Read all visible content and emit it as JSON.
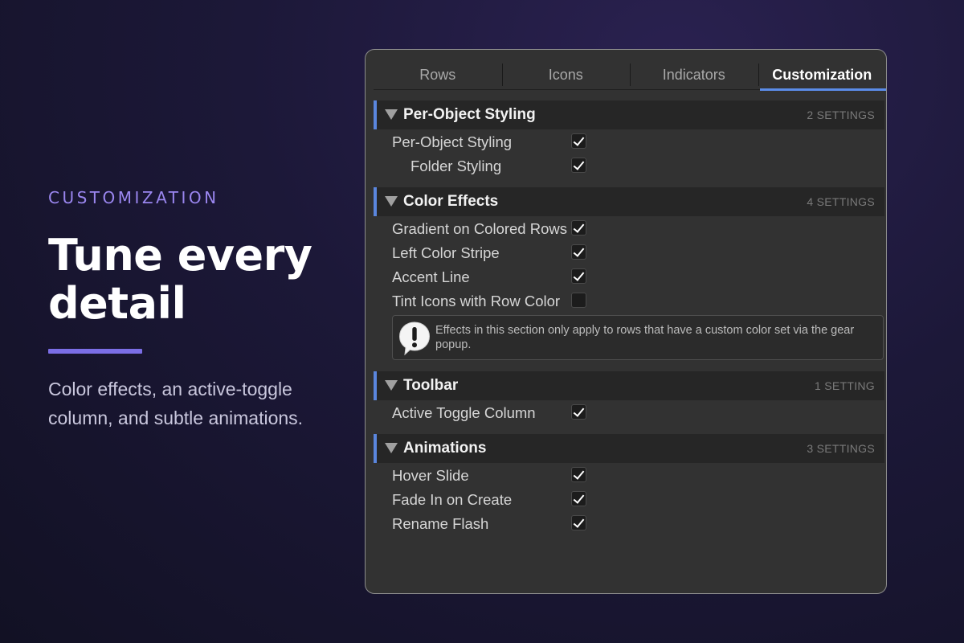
{
  "hero": {
    "eyebrow": "CUSTOMIZATION",
    "headline_line1": "Tune every",
    "headline_line2": "detail",
    "subtext": "Color effects, an active-toggle column, and subtle animations."
  },
  "colors": {
    "accent": "#7b6ee6",
    "eyebrow": "#9a86ef",
    "tab_active_underline": "#5b8ce8",
    "section_stripe": "#5a86de"
  },
  "panel": {
    "tabs": [
      {
        "label": "Rows",
        "active": false
      },
      {
        "label": "Icons",
        "active": false
      },
      {
        "label": "Indicators",
        "active": false
      },
      {
        "label": "Customization",
        "active": true
      }
    ],
    "sections": [
      {
        "title": "Per-Object Styling",
        "count": "2 SETTINGS",
        "items": [
          {
            "label": "Per-Object Styling",
            "checked": true
          },
          {
            "label": "Folder Styling",
            "checked": true
          }
        ]
      },
      {
        "title": "Color Effects",
        "count": "4 SETTINGS",
        "items": [
          {
            "label": "Gradient on Colored Rows",
            "checked": true
          },
          {
            "label": "Left Color Stripe",
            "checked": true
          },
          {
            "label": "Accent Line",
            "checked": true
          },
          {
            "label": "Tint Icons with Row Color",
            "checked": false
          }
        ],
        "note": {
          "icon": "exclamation-speech-bubble-icon",
          "text": "Effects in this section only apply to rows that have a custom color set via the gear popup."
        }
      },
      {
        "title": "Toolbar",
        "count": "1 SETTING",
        "items": [
          {
            "label": "Active Toggle Column",
            "checked": true
          }
        ]
      },
      {
        "title": "Animations",
        "count": "3 SETTINGS",
        "items": [
          {
            "label": "Hover Slide",
            "checked": true
          },
          {
            "label": "Fade In on Create",
            "checked": true
          },
          {
            "label": "Rename Flash",
            "checked": true
          }
        ]
      }
    ]
  }
}
